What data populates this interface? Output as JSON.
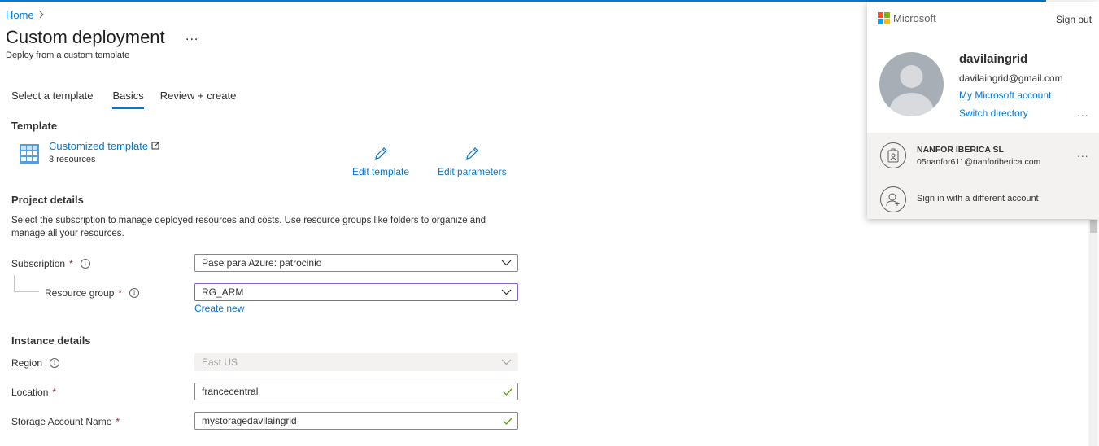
{
  "breadcrumb": {
    "home": "Home",
    "separator": ">"
  },
  "page": {
    "title": "Custom deployment",
    "more": "...",
    "subtitle": "Deploy from a custom template"
  },
  "tabs": [
    {
      "label": "Select a template",
      "active": false
    },
    {
      "label": "Basics",
      "active": true
    },
    {
      "label": "Review + create",
      "active": false
    }
  ],
  "template": {
    "heading": "Template",
    "link_label": "Customized template",
    "resources": "3 resources",
    "edit_template": "Edit template",
    "edit_parameters": "Edit parameters"
  },
  "project": {
    "heading": "Project details",
    "description": "Select the subscription to manage deployed resources and costs. Use resource groups like folders to organize and manage all your resources.",
    "subscription_label": "Subscription",
    "subscription_value": "Pase para Azure: patrocinio",
    "resource_group_label": "Resource group",
    "resource_group_value": "RG_ARM",
    "create_new": "Create new"
  },
  "instance": {
    "heading": "Instance details",
    "region_label": "Region",
    "region_value": "East US",
    "location_label": "Location",
    "location_value": "francecentral",
    "storage_label": "Storage Account Name",
    "storage_value": "mystoragedavilaingrid"
  },
  "required_mark": "*",
  "account": {
    "brand": "Microsoft",
    "sign_out": "Sign out",
    "name": "davilaingrid",
    "email": "davilaingrid@gmail.com",
    "my_account": "My Microsoft account",
    "switch_directory": "Switch directory",
    "dots": "...",
    "org_name": "NANFOR IBERICA SL",
    "org_email": "05nanfor611@nanforiberica.com",
    "different_account": "Sign in with a different account"
  },
  "colors": {
    "accent": "#0078d4",
    "valid_check": "#57a300",
    "required": "#a4262c",
    "focus_border": "#8661c5",
    "ms_red": "#f25022",
    "ms_green": "#7fba00",
    "ms_blue": "#00a4ef",
    "ms_yellow": "#ffb900"
  },
  "icons": {
    "template": "template-grid-icon",
    "external": "external-link-icon",
    "edit": "pencil-icon",
    "info": "info-icon",
    "dropdown": "chevron-down-icon",
    "valid": "checkmark-icon",
    "avatar": "person-avatar-icon",
    "badge": "badge-icon",
    "add_person": "add-person-icon"
  }
}
